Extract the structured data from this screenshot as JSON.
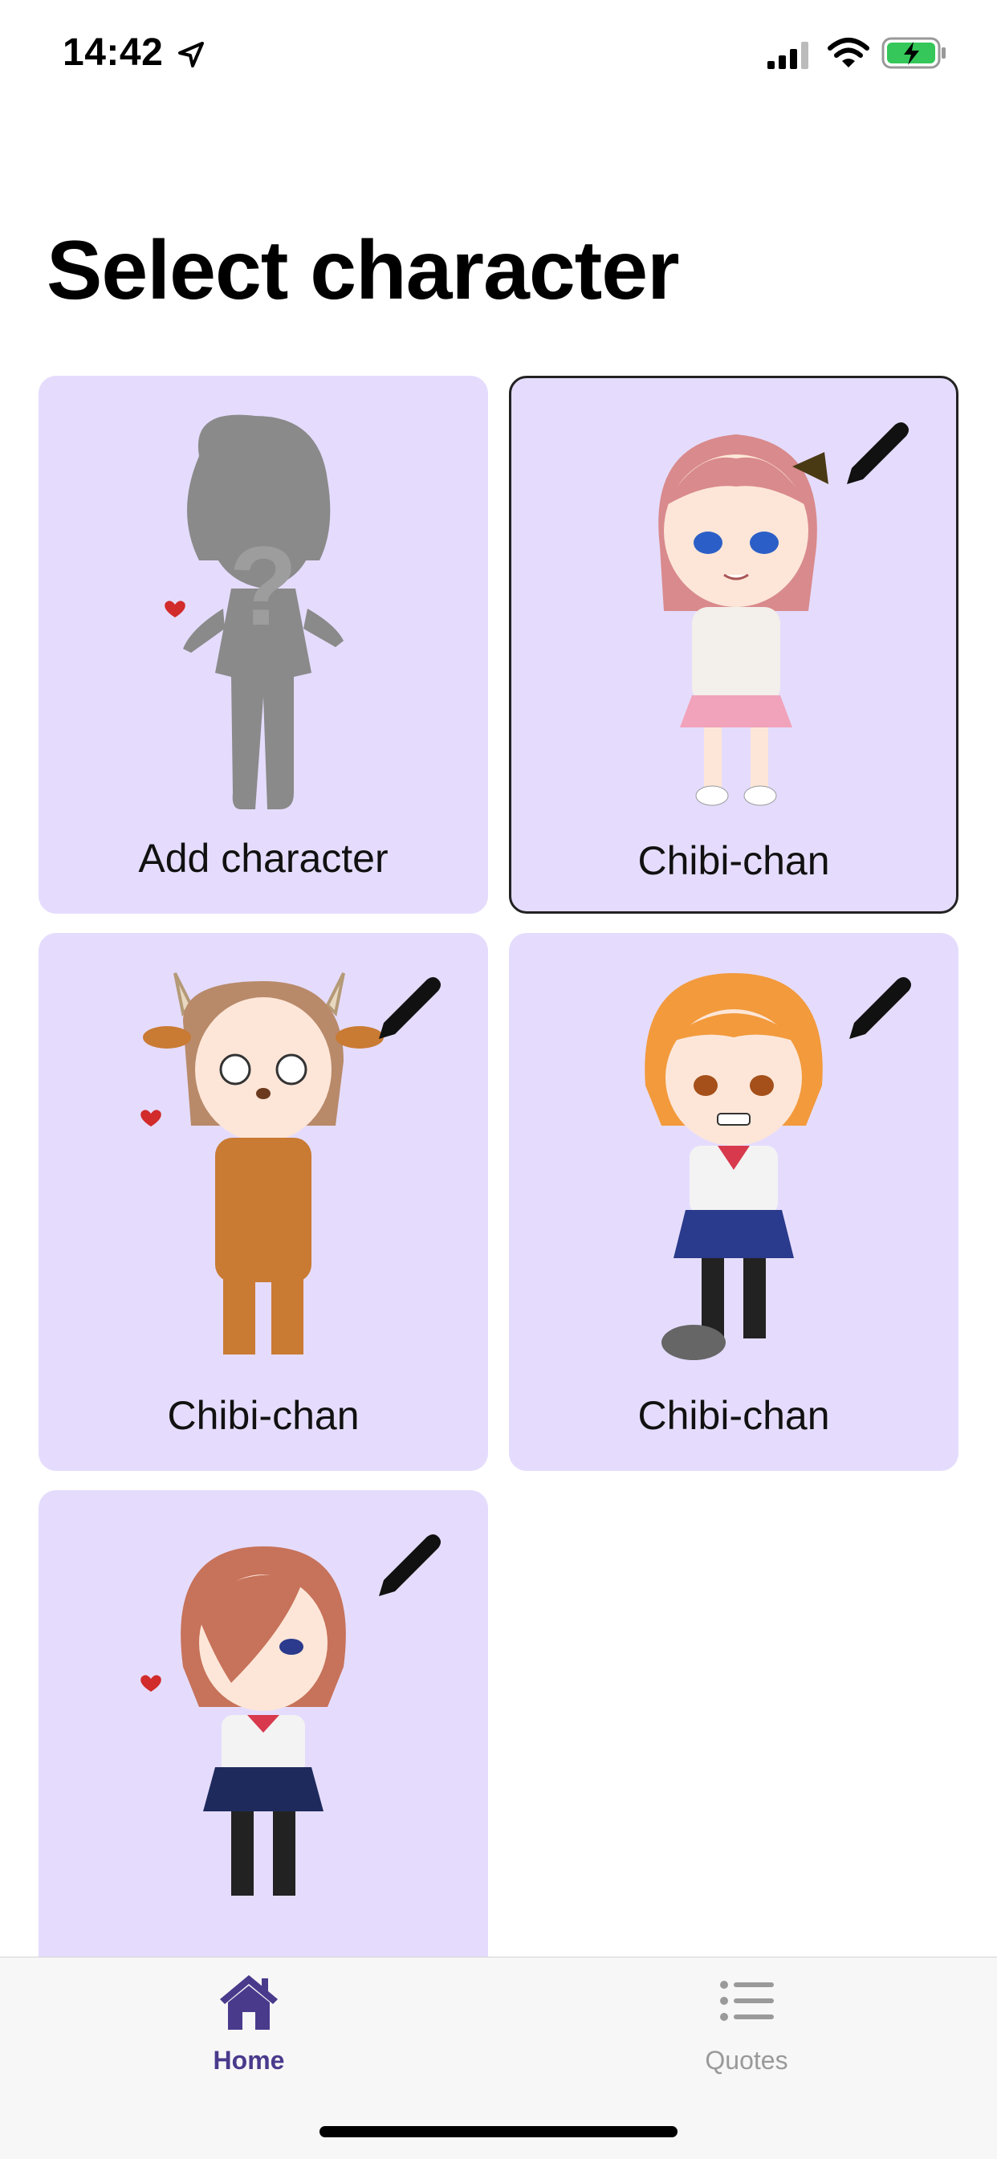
{
  "status": {
    "time": "14:42",
    "icons": [
      "location-arrow-icon",
      "signal-icon",
      "wifi-icon",
      "battery-charging-icon"
    ]
  },
  "title": "Select character",
  "cards": [
    {
      "label": "Add character",
      "type": "add",
      "selected": false,
      "editable": false
    },
    {
      "label": "Chibi-chan",
      "type": "character",
      "hair": "#d98a8c",
      "outfit": "#f3efea",
      "selected": true,
      "editable": true
    },
    {
      "label": "Chibi-chan",
      "type": "character",
      "hair": "#b88a6a",
      "outfit": "#c97a33",
      "selected": false,
      "editable": true
    },
    {
      "label": "Chibi-chan",
      "type": "character",
      "hair": "#f29a3c",
      "outfit": "#2a3a8c",
      "selected": false,
      "editable": true
    },
    {
      "label": "",
      "type": "character",
      "hair": "#c7725a",
      "outfit": "#1f2a5c",
      "selected": false,
      "editable": true
    }
  ],
  "tabs": [
    {
      "label": "Home",
      "icon": "home-icon",
      "active": true
    },
    {
      "label": "Quotes",
      "icon": "list-icon",
      "active": false
    }
  ],
  "colors": {
    "card_bg": "#e5dcfd",
    "accent": "#4a3a8c",
    "inactive_tab": "#9a9a9a"
  }
}
